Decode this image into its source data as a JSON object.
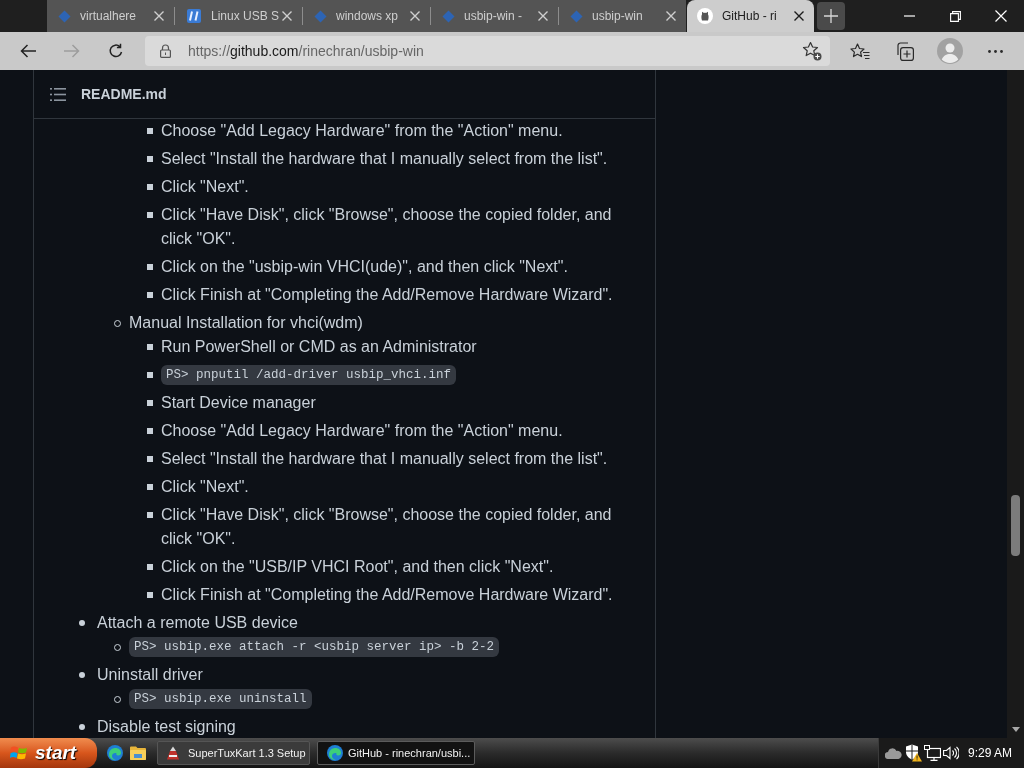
{
  "browser": {
    "tabs": [
      {
        "title": "virtualhere",
        "kind": "plain",
        "selected": false
      },
      {
        "title": "Linux USB S",
        "kind": "site",
        "selected": false
      },
      {
        "title": "windows xp",
        "kind": "plain",
        "selected": false
      },
      {
        "title": "usbip-win -",
        "kind": "plain",
        "selected": false
      },
      {
        "title": "usbip-win",
        "kind": "plain",
        "selected": false
      },
      {
        "title": "GitHub - ri",
        "kind": "github",
        "selected": true
      }
    ],
    "toolbar": {
      "buttons": [
        {
          "kind": "back",
          "disabled": false
        },
        {
          "kind": "forward",
          "disabled": true
        },
        {
          "kind": "refresh",
          "disabled": false
        }
      ],
      "address": {
        "scheme": "https://",
        "host": "github.com",
        "path": "/rinechran/usbip-win"
      }
    }
  },
  "readme": {
    "title": "README.md",
    "items": [
      {
        "children": [
          {
            "children": [
              {
                "kind": "text",
                "text": "Choose \"Add Legacy Hardware\" from the \"Action\" menu."
              },
              {
                "kind": "text",
                "text": "Select \"Install the hardware that I manually select from the list\"."
              },
              {
                "kind": "text",
                "text": "Click \"Next\"."
              },
              {
                "kind": "text",
                "text": "Click \"Have Disk\", click \"Browse\", choose the copied folder, and click \"OK\"."
              },
              {
                "kind": "text",
                "text": "Click on the \"usbip-win VHCI(ude)\", and then click \"Next\"."
              },
              {
                "kind": "text",
                "text": "Click Finish at \"Completing the Add/Remove Hardware Wizard\"."
              }
            ]
          },
          {
            "kind": "text",
            "text": "Manual Installation for vhci(wdm)",
            "children": [
              {
                "kind": "text",
                "text": "Run PowerShell or CMD as an Administrator"
              },
              {
                "kind": "code",
                "text": "PS> pnputil /add-driver usbip_vhci.inf"
              },
              {
                "kind": "text",
                "text": "Start Device manager"
              },
              {
                "kind": "text",
                "text": "Choose \"Add Legacy Hardware\" from the \"Action\" menu."
              },
              {
                "kind": "text",
                "text": "Select \"Install the hardware that I manually select from the list\"."
              },
              {
                "kind": "text",
                "text": "Click \"Next\"."
              },
              {
                "kind": "text",
                "text": "Click \"Have Disk\", click \"Browse\", choose the copied folder, and click \"OK\"."
              },
              {
                "kind": "text",
                "text": "Click on the \"USB/IP VHCI Root\", and then click \"Next\"."
              },
              {
                "kind": "text",
                "text": "Click Finish at \"Completing the Add/Remove Hardware Wizard\"."
              }
            ]
          }
        ]
      },
      {
        "kind": "text",
        "text": "Attach a remote USB device",
        "children": [
          {
            "kind": "code",
            "text": "PS> usbip.exe attach -r <usbip server ip> -b 2-2"
          }
        ]
      },
      {
        "kind": "text",
        "text": "Uninstall driver",
        "children": [
          {
            "kind": "code",
            "text": "PS> usbip.exe uninstall"
          }
        ]
      },
      {
        "kind": "text",
        "text": "Disable test signing"
      }
    ]
  },
  "taskbar": {
    "start": "start",
    "tasks": [
      {
        "title": "SuperTuxKart 1.3 Setup",
        "kind": "installer",
        "selected": false
      },
      {
        "title": "GitHub - rinechran/usbi...",
        "kind": "browser",
        "selected": true
      }
    ],
    "clock": "9:29 AM"
  }
}
